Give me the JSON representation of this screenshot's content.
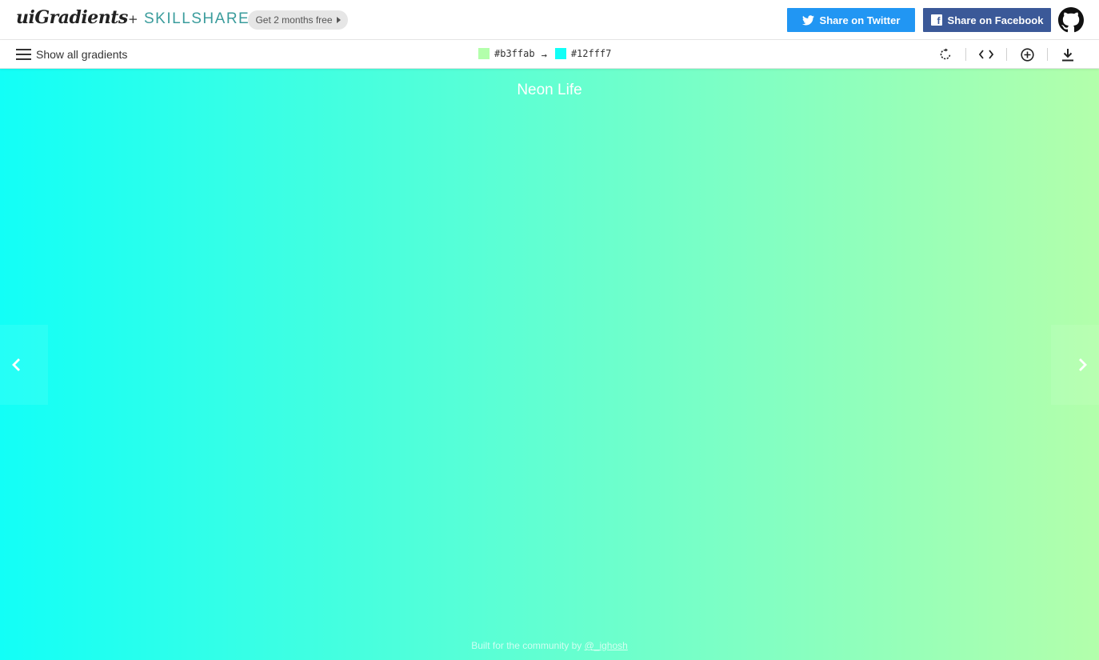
{
  "header": {
    "logo_text": "uiGradients",
    "plus": "+",
    "partner": "SKILLSHARE",
    "promo_label": "Get 2 months free",
    "twitter_label": "Share on Twitter",
    "facebook_label": "Share on Facebook",
    "facebook_glyph": "f",
    "icons": [
      "twitter-icon",
      "facebook-icon",
      "github-icon",
      "caret-right-icon"
    ]
  },
  "toolbar": {
    "menu_label": "Show all gradients",
    "color_from": "#b3ffab",
    "color_to": "#12fff7",
    "arrow": "→",
    "icons": [
      "rotate-icon",
      "code-icon",
      "add-circle-icon",
      "download-icon"
    ]
  },
  "gradient": {
    "name": "Neon Life",
    "colors": [
      "#12fff7",
      "#b3ffab"
    ]
  },
  "navigation": {
    "icons": [
      "chevron-left-icon",
      "chevron-right-icon"
    ]
  },
  "footer": {
    "text": "Built for the community by",
    "author": "@_ighosh"
  },
  "colors": {
    "twitter": "#2196f3",
    "facebook": "#3b5998",
    "skillshare": "#3a9c9c"
  }
}
